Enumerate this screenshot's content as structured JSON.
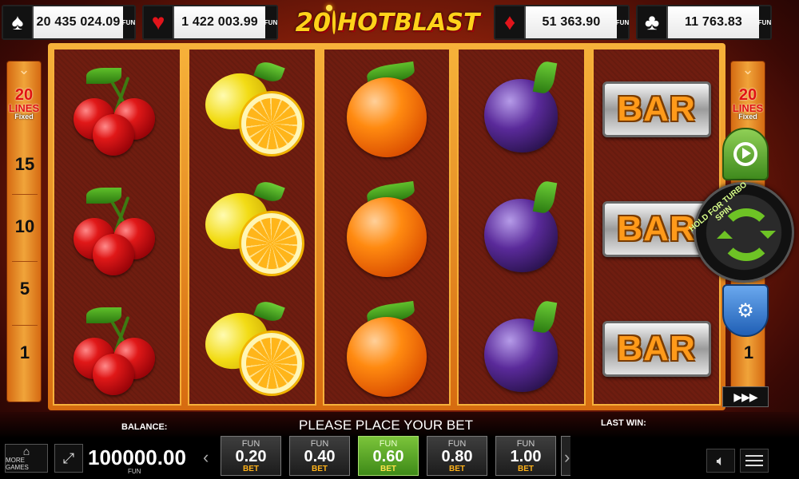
{
  "jackpots": [
    {
      "suit": "spade",
      "glyph": "♠",
      "value": "20 435 024.09",
      "fun": "FUN"
    },
    {
      "suit": "heart",
      "glyph": "♥",
      "value": "1 422 003.99",
      "fun": "FUN"
    },
    {
      "suit": "diamond",
      "glyph": "♦",
      "value": "51 363.90",
      "fun": "FUN"
    },
    {
      "suit": "club",
      "glyph": "♣",
      "value": "11 763.83",
      "fun": "FUN"
    }
  ],
  "logo": {
    "number": "20",
    "word": "HOTBLAST"
  },
  "lines_panel": {
    "count": "20",
    "label": "LINES",
    "mode": "Fixed",
    "markers": [
      "15",
      "10",
      "5",
      "1"
    ]
  },
  "reels": [
    [
      "cherry",
      "cherry",
      "cherry"
    ],
    [
      "lemon",
      "lemon",
      "lemon"
    ],
    [
      "orange",
      "orange",
      "orange"
    ],
    [
      "plum",
      "plum",
      "plum"
    ],
    [
      "bar",
      "bar",
      "bar"
    ]
  ],
  "symbols": {
    "bar_text": "BAR"
  },
  "controls": {
    "spin_hint": "HOLD FOR TURBO SPIN",
    "turbo_label": "▶▶▶"
  },
  "bottom": {
    "balance_label": "BALANCE:",
    "balance_value": "100000.00",
    "balance_currency": "FUN",
    "message": "PLEASE PLACE YOUR BET",
    "last_win_label": "LAST WIN:",
    "more_games_label": "MORE GAMES"
  },
  "bets": [
    {
      "currency": "FUN",
      "value": "0.20",
      "label": "BET",
      "active": false
    },
    {
      "currency": "FUN",
      "value": "0.40",
      "label": "BET",
      "active": false
    },
    {
      "currency": "FUN",
      "value": "0.60",
      "label": "BET",
      "active": true
    },
    {
      "currency": "FUN",
      "value": "0.80",
      "label": "BET",
      "active": false
    },
    {
      "currency": "FUN",
      "value": "1.00",
      "label": "BET",
      "active": false
    }
  ],
  "colors": {
    "accent_green": "#6ec325",
    "bet_gold": "#ffb21a",
    "line_red": "#e11212"
  }
}
